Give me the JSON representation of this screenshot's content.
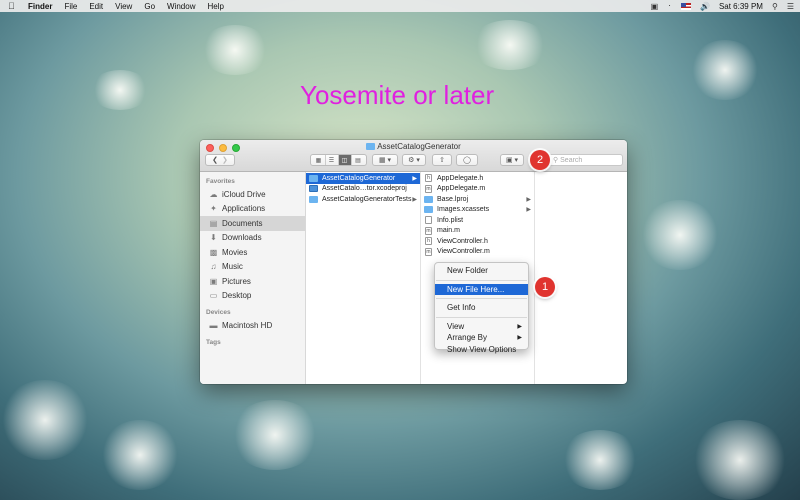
{
  "menubar": {
    "app": "Finder",
    "menus": [
      "File",
      "Edit",
      "View",
      "Go",
      "Window",
      "Help"
    ],
    "clock": "Sat 6:39 PM",
    "icons": [
      "apple-icon",
      "bluetooth-icon",
      "flag-icon",
      "volume-icon",
      "spotlight-icon",
      "notification-icon",
      "menu-extra-icon"
    ]
  },
  "headline": "Yosemite or later",
  "window": {
    "title": "AssetCatalogGenerator",
    "search_placeholder": "Search"
  },
  "sidebar": {
    "favorites_heading": "Favorites",
    "favorites": [
      {
        "label": "iCloud Drive",
        "icon": "cloud-icon"
      },
      {
        "label": "Applications",
        "icon": "applications-icon"
      },
      {
        "label": "Documents",
        "icon": "documents-icon",
        "selected": true
      },
      {
        "label": "Downloads",
        "icon": "downloads-icon"
      },
      {
        "label": "Movies",
        "icon": "movies-icon"
      },
      {
        "label": "Music",
        "icon": "music-icon"
      },
      {
        "label": "Pictures",
        "icon": "pictures-icon"
      },
      {
        "label": "Desktop",
        "icon": "desktop-icon"
      }
    ],
    "devices_heading": "Devices",
    "devices": [
      {
        "label": "Macintosh HD",
        "icon": "disk-icon"
      }
    ],
    "tags_heading": "Tags"
  },
  "columns": {
    "col1": [
      {
        "label": "AssetCatalogGenerator",
        "type": "folder",
        "selected": true,
        "has_children": true
      },
      {
        "label": "AssetCatalo…tor.xcodeproj",
        "type": "project"
      },
      {
        "label": "AssetCatalogGeneratorTests",
        "type": "folder",
        "has_children": true
      }
    ],
    "col2": [
      {
        "label": "AppDelegate.h",
        "type": "file",
        "glyph": "h"
      },
      {
        "label": "AppDelegate.m",
        "type": "file",
        "glyph": "m"
      },
      {
        "label": "Base.lproj",
        "type": "folder",
        "has_children": true
      },
      {
        "label": "Images.xcassets",
        "type": "folder",
        "has_children": true
      },
      {
        "label": "Info.plist",
        "type": "file",
        "glyph": ""
      },
      {
        "label": "main.m",
        "type": "file",
        "glyph": "m"
      },
      {
        "label": "ViewController.h",
        "type": "file",
        "glyph": "h"
      },
      {
        "label": "ViewController.m",
        "type": "file",
        "glyph": "m"
      }
    ]
  },
  "context_menu": {
    "new_folder": "New Folder",
    "new_file_here": "New File Here...",
    "get_info": "Get Info",
    "view": "View",
    "arrange_by": "Arrange By",
    "show_view_options": "Show View Options"
  },
  "badges": {
    "one": "1",
    "two": "2"
  },
  "colors": {
    "selection": "#1e68d6",
    "headline": "#e020e0",
    "badge": "#e0342f"
  }
}
